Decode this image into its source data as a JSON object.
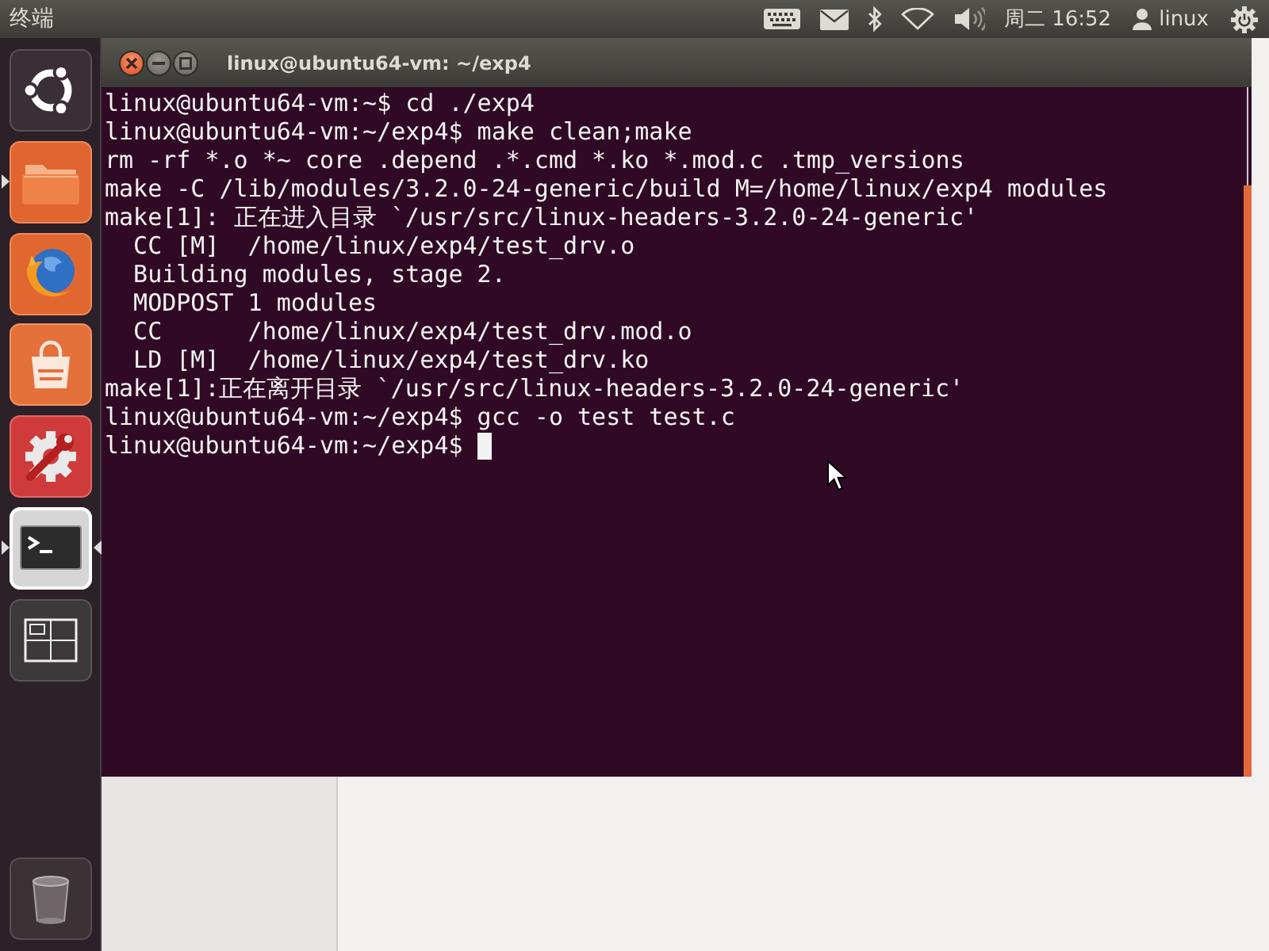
{
  "top_panel": {
    "app_title": "终端",
    "clock": "周二 16:52",
    "user": "linux"
  },
  "launcher": {
    "items": [
      {
        "kind": "dash",
        "running": false,
        "selected": false
      },
      {
        "kind": "files",
        "running": true,
        "selected": false
      },
      {
        "kind": "browser",
        "running": false,
        "selected": false
      },
      {
        "kind": "software",
        "running": false,
        "selected": false
      },
      {
        "kind": "settings",
        "running": false,
        "selected": false
      },
      {
        "kind": "terminal",
        "running": true,
        "selected": true
      },
      {
        "kind": "workspaces",
        "running": false,
        "selected": false
      },
      {
        "kind": "trash",
        "running": false,
        "selected": false
      }
    ]
  },
  "window": {
    "title": "linux@ubuntu64-vm: ~/exp4",
    "lines": [
      "linux@ubuntu64-vm:~$ cd ./exp4",
      "linux@ubuntu64-vm:~/exp4$ make clean;make",
      "rm -rf *.o *~ core .depend .*.cmd *.ko *.mod.c .tmp_versions",
      "make -C /lib/modules/3.2.0-24-generic/build M=/home/linux/exp4 modules",
      "make[1]: 正在进入目录 `/usr/src/linux-headers-3.2.0-24-generic'",
      "  CC [M]  /home/linux/exp4/test_drv.o",
      "  Building modules, stage 2.",
      "  MODPOST 1 modules",
      "  CC      /home/linux/exp4/test_drv.mod.o",
      "  LD [M]  /home/linux/exp4/test_drv.ko",
      "make[1]:正在离开目录 `/usr/src/linux-headers-3.2.0-24-generic'",
      "linux@ubuntu64-vm:~/exp4$ gcc -o test test.c",
      "linux@ubuntu64-vm:~/exp4$"
    ]
  }
}
